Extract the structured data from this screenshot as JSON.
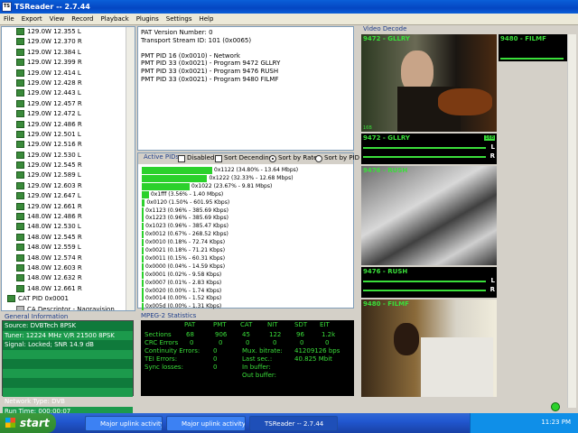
{
  "window": {
    "title": "TSReader -- 2.7.44",
    "icon_text": "TS"
  },
  "menu": [
    "File",
    "Export",
    "View",
    "Record",
    "Playback",
    "Plugins",
    "Settings",
    "Help"
  ],
  "tree": {
    "items": [
      "129.0W 12.355 L",
      "129.0W 12.370 R",
      "129.0W 12.384 L",
      "129.0W 12.399 R",
      "129.0W 12.414 L",
      "129.0W 12.428 R",
      "129.0W 12.443 L",
      "129.0W 12.457 R",
      "129.0W 12.472 L",
      "129.0W 12.486 R",
      "129.0W 12.501 L",
      "129.0W 12.516 R",
      "129.0W 12.530 L",
      "129.0W 12.545 R",
      "129.0W 12.589 L",
      "129.0W 12.603 R",
      "129.0W 12.647 L",
      "129.0W 12.661 R",
      "148.0W 12.486 R",
      "148.0W 12.530 L",
      "148.0W 12.545 R",
      "148.0W 12.559 L",
      "148.0W 12.574 R",
      "148.0W 12.603 R",
      "148.0W 12.632 R",
      "148.0W 12.661 R"
    ],
    "cat": "CAT PID 0x0001",
    "ca": [
      "CA Descriptor - Nagravision",
      "CA Descriptor - Nagravision",
      "CA Descriptor - Nagravision",
      "CA Descriptor - Nagravision"
    ]
  },
  "general_info": {
    "title": "General Information",
    "lines": [
      "Source: DVBTech 8PSK",
      "Tuner: 12224 MHz V/R 21500 8PSK",
      "Signal: Locked; SNR 14.9 dB",
      "",
      "",
      "",
      "",
      "",
      "Network Type: DVB",
      "Run Time: 000:00:07"
    ]
  },
  "pat": [
    "PAT Version Number: 0",
    "Transport Stream ID: 101 (0x0065)",
    "",
    "PMT PID 16 (0x0010) - Network",
    "PMT PID 33 (0x0021) - Program 9472 GLLRY",
    "PMT PID 33 (0x0021) - Program 9476 RUSH",
    "PMT PID 33 (0x0021) - Program 9480 FILMF"
  ],
  "pids": {
    "title": "Active PIDs",
    "disabled": "Disabled",
    "sort_desc": "Sort Decending",
    "sort_rate": "Sort by Rate",
    "sort_pid": "Sort by PID",
    "rows": [
      {
        "pct": 34.8,
        "text": "0x1122 (34.80% - 13.64 Mbps)"
      },
      {
        "pct": 32.33,
        "text": "0x1222 (32.33% - 12.68 Mbps)"
      },
      {
        "pct": 23.67,
        "text": "0x1022 (23.67% - 9.81 Mbps)"
      },
      {
        "pct": 3.56,
        "text": "0x1fff (3.56% - 1.40 Mbps)"
      },
      {
        "pct": 1.5,
        "text": "0x0120 (1.50% - 601.95 Kbps)"
      },
      {
        "pct": 0.96,
        "text": "0x1123 (0.96% - 385.69 Kbps)"
      },
      {
        "pct": 0.96,
        "text": "0x1223 (0.96% - 385.69 Kbps)"
      },
      {
        "pct": 0.96,
        "text": "0x1023 (0.96% - 385.47 Kbps)"
      },
      {
        "pct": 0.67,
        "text": "0x0012 (0.67% - 268.52 Kbps)"
      },
      {
        "pct": 0.18,
        "text": "0x0010 (0.18% - 72.74 Kbps)"
      },
      {
        "pct": 0.18,
        "text": "0x0021 (0.18% - 71.21 Kbps)"
      },
      {
        "pct": 0.15,
        "text": "0x0011 (0.15% - 60.31 Kbps)"
      },
      {
        "pct": 0.04,
        "text": "0x0000 (0.04% - 14.59 Kbps)"
      },
      {
        "pct": 0.02,
        "text": "0x0001 (0.02% - 9.58 Kbps)"
      },
      {
        "pct": 0.01,
        "text": "0x0007 (0.01% - 2.83 Kbps)"
      },
      {
        "pct": 0.0,
        "text": "0x0020 (0.00% - 1.74 Kbps)"
      },
      {
        "pct": 0.0,
        "text": "0x0014 (0.00% - 1.52 Kbps)"
      },
      {
        "pct": 0.0,
        "text": "0x005d (0.00% - 1.31 Kbps)"
      }
    ]
  },
  "mpeg": {
    "title": "MPEG-2 Statistics",
    "cols": [
      "PAT",
      "PMT",
      "CAT",
      "NIT",
      "SDT",
      "EIT"
    ],
    "sections_label": "Sections",
    "sections": [
      "68",
      "906",
      "45",
      "122",
      "96",
      "1.2k"
    ],
    "crc_label": "CRC Errors",
    "crc": [
      "0",
      "0",
      "0",
      "0",
      "0",
      "0"
    ],
    "continuity_label": "Continuity Errors:",
    "continuity": "0",
    "tei_label": "TEI Errors:",
    "tei": "0",
    "sync_label": "Sync losses:",
    "sync": "0",
    "mux_label": "Mux. bitrate:",
    "mux": "41209126 bps",
    "last_label": "Last sec.:",
    "last": "40.825 Mbit",
    "inbuf_label": "In buffer:",
    "outbuf_label": "Out buffer:"
  },
  "video": {
    "title": "Video Decode",
    "p1": "9472 - GLLRY",
    "p2": "9480 - FILMF",
    "p3": "9472 - GLLRY",
    "p4": "9476 - RUSH",
    "p5": "9476 - RUSH",
    "p6": "9480 - FILMF",
    "tag": "16B",
    "tag2": "16B",
    "l": "L",
    "r": "R"
  },
  "taskbar": {
    "start": "start",
    "tasks": [
      "Major uplink activity F...",
      "Major uplink activity F...",
      "TSReader -- 2.7.44"
    ],
    "time": "11:23 PM"
  }
}
